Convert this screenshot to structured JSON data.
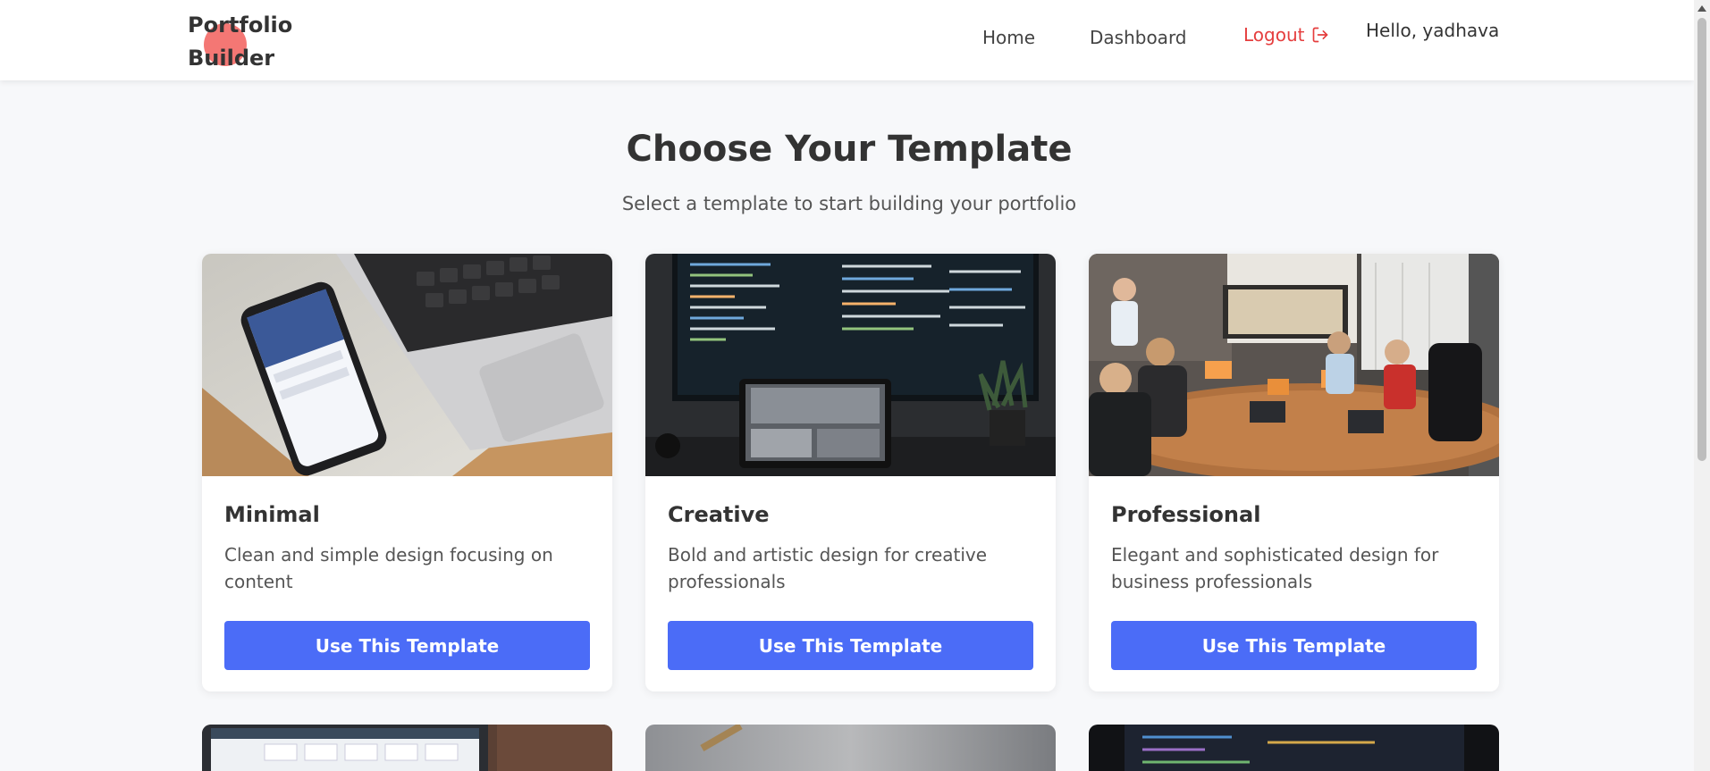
{
  "header": {
    "logo_line1": "Portfolio",
    "logo_line2": "Builder",
    "nav": {
      "home": "Home",
      "dashboard": "Dashboard",
      "logout": "Logout",
      "greeting": "Hello, yadhava"
    }
  },
  "main": {
    "title": "Choose Your Template",
    "subtitle": "Select a template to start building your portfolio",
    "templates": [
      {
        "name": "Minimal",
        "description": "Clean and simple design focusing on content",
        "button": "Use This Template"
      },
      {
        "name": "Creative",
        "description": "Bold and artistic design for creative professionals",
        "button": "Use This Template"
      },
      {
        "name": "Professional",
        "description": "Elegant and sophisticated design for business professionals",
        "button": "Use This Template"
      }
    ]
  },
  "colors": {
    "primary_button": "#4b6cf7",
    "logout": "#e53e3e",
    "logo_accent": "#f25f5c"
  },
  "icons": [
    "logout-icon"
  ]
}
